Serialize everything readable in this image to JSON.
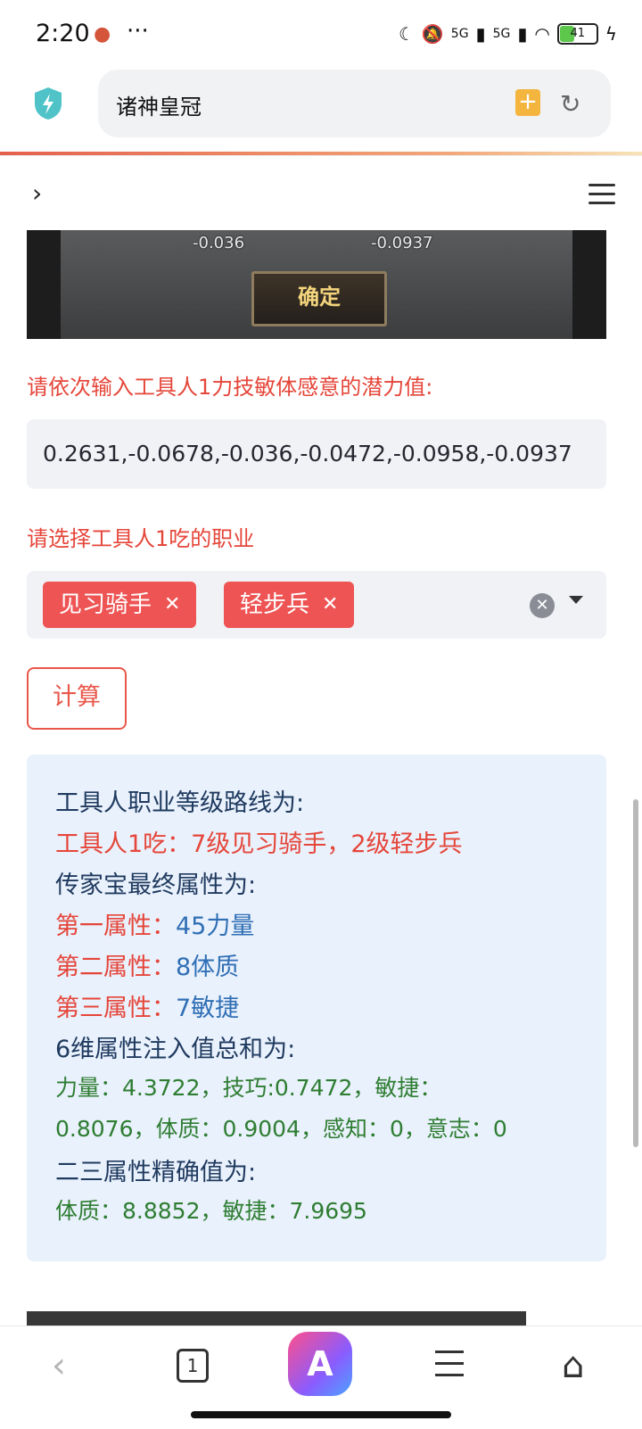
{
  "status_bar": {
    "time": "2:20",
    "more": "···",
    "network_1": "5G",
    "network_2": "5G",
    "battery": "41"
  },
  "browser": {
    "address_text": "诸神皇冠",
    "tab_count": "1"
  },
  "game_panel": {
    "value_left": "-0.036",
    "value_right": "-0.0937",
    "confirm_label": "确定"
  },
  "form": {
    "potential_label": "请依次输入工具人1力技敏体感意的潜力值:",
    "potential_value": "0.2631,-0.0678,-0.036,-0.0472,-0.0958,-0.0937",
    "job_label": "请选择工具人1吃的职业",
    "selected_jobs": [
      "见习骑手",
      "轻步兵"
    ],
    "calc_label": "计算"
  },
  "result": {
    "route_title": "工具人职业等级路线为:",
    "route_value": "工具人1吃：7级见习骑手，2级轻步兵",
    "heirloom_title": "传家宝最终属性为:",
    "attr1_label": "第一属性：",
    "attr1_value": "45力量",
    "attr2_label": "第二属性：",
    "attr2_value": "8体质",
    "attr3_label": "第三属性：",
    "attr3_value": "7敏捷",
    "sum_title": "6维属性注入值总和为:",
    "sum_line1": "力量：4.3722，技巧:0.7472，敏捷：",
    "sum_line2": "0.8076，体质：0.9004，感知：0，意志：0",
    "exact_title": "二三属性精确值为:",
    "exact_value": "体质：8.8852，敏捷：7.9695"
  },
  "colors": {
    "accent_red": "#e5463a",
    "tag_red": "#ee5454",
    "result_bg": "#e9f1fc",
    "green": "#2e7d32",
    "blue": "#2f6fb5"
  }
}
